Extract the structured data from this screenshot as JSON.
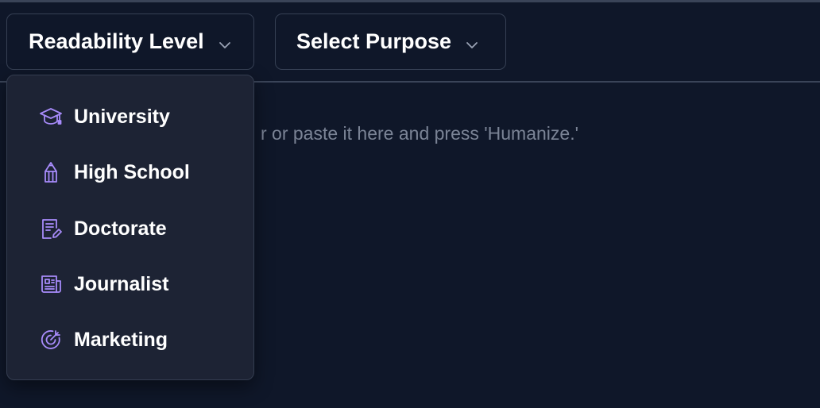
{
  "toolbar": {
    "readability_label": "Readability Level",
    "purpose_label": "Select Purpose"
  },
  "editor": {
    "placeholder_visible": "r or paste it here and press 'Humanize.'"
  },
  "readability_menu": {
    "items": [
      {
        "label": "University",
        "icon": "graduation-cap-icon"
      },
      {
        "label": "High School",
        "icon": "pencil-icon"
      },
      {
        "label": "Doctorate",
        "icon": "document-edit-icon"
      },
      {
        "label": "Journalist",
        "icon": "newspaper-icon"
      },
      {
        "label": "Marketing",
        "icon": "target-icon"
      }
    ]
  },
  "colors": {
    "background": "#0f1729",
    "menu_background": "#1d2334",
    "border": "#364054",
    "icon_accent": "#a78bfa",
    "text": "#ffffff",
    "placeholder_text": "#7b8496"
  }
}
